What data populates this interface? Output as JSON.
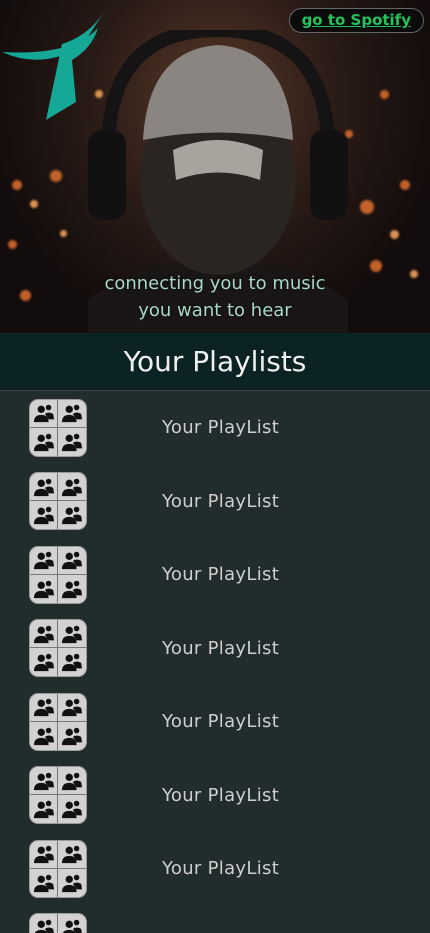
{
  "header": {
    "spotify_link": "go to Spotify",
    "tagline_line1": "connecting you to music",
    "tagline_line2": "you want to hear",
    "logo_icon": "teal-bird-logo"
  },
  "section": {
    "title": "Your Playlists"
  },
  "playlists": [
    {
      "label": "Your PlayList",
      "icon": "people-group-icon"
    },
    {
      "label": "Your PlayList",
      "icon": "people-group-icon"
    },
    {
      "label": "Your PlayList",
      "icon": "people-group-icon"
    },
    {
      "label": "Your PlayList",
      "icon": "people-group-icon"
    },
    {
      "label": "Your PlayList",
      "icon": "people-group-icon"
    },
    {
      "label": "Your PlayList",
      "icon": "people-group-icon"
    },
    {
      "label": "Your PlayList",
      "icon": "people-group-icon"
    },
    {
      "label": "",
      "icon": "people-group-icon"
    }
  ],
  "colors": {
    "accent_teal": "#16a896",
    "spotify_green": "#23c25a",
    "list_bg": "#212c2d",
    "title_bar_bg": "#0c2324"
  }
}
